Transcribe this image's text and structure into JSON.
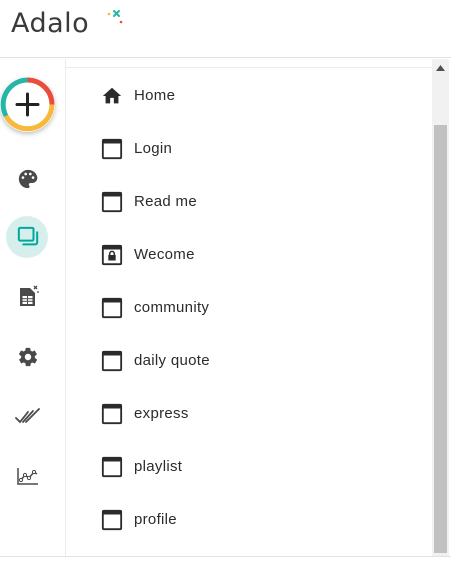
{
  "app": {
    "logo_text": "Adalo"
  },
  "sidebar": {
    "items": [
      {
        "name": "add"
      },
      {
        "name": "branding"
      },
      {
        "name": "screens",
        "active": true
      },
      {
        "name": "database"
      },
      {
        "name": "settings"
      },
      {
        "name": "publish"
      },
      {
        "name": "analytics"
      }
    ]
  },
  "screens": [
    {
      "label": "Home",
      "icon": "home-icon"
    },
    {
      "label": "Login",
      "icon": "screen-icon"
    },
    {
      "label": "Read me",
      "icon": "screen-icon"
    },
    {
      "label": "Wecome",
      "icon": "locked-screen-icon"
    },
    {
      "label": "community",
      "icon": "screen-icon"
    },
    {
      "label": "daily quote",
      "icon": "screen-icon"
    },
    {
      "label": "express",
      "icon": "screen-icon"
    },
    {
      "label": "playlist",
      "icon": "screen-icon"
    },
    {
      "label": "profile",
      "icon": "screen-icon"
    }
  ],
  "colors": {
    "accent_teal": "#00a79d",
    "active_bg": "#d6efed",
    "logo_red": "#e94e3c",
    "logo_yellow": "#f6b93b",
    "logo_teal": "#25b6a8"
  }
}
